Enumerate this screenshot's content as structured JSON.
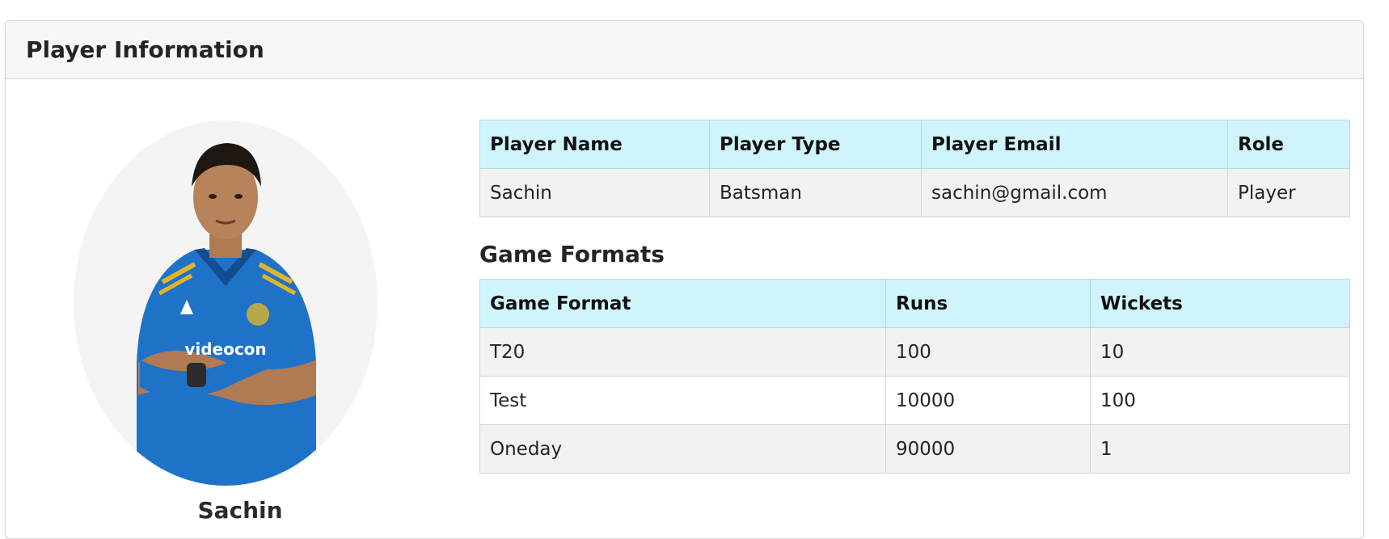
{
  "header": {
    "title": "Player Information"
  },
  "profile": {
    "name": "Sachin",
    "image_icon": "player-photo"
  },
  "player_table": {
    "columns": [
      "Player Name",
      "Player Type",
      "Player Email",
      "Role"
    ],
    "rows": [
      [
        "Sachin",
        "Batsman",
        "sachin@gmail.com",
        "Player"
      ]
    ]
  },
  "game_formats": {
    "title": "Game Formats",
    "columns": [
      "Game Format",
      "Runs",
      "Wickets"
    ],
    "rows": [
      [
        "T20",
        "100",
        "10"
      ],
      [
        "Test",
        "10000",
        "100"
      ],
      [
        "Oneday",
        "90000",
        "1"
      ]
    ]
  },
  "colors": {
    "table_header_bg": "#cff4fc",
    "striped_row_bg": "#f2f2f2",
    "card_header_bg": "#f7f7f7",
    "jersey_blue": "#1e73c9"
  }
}
